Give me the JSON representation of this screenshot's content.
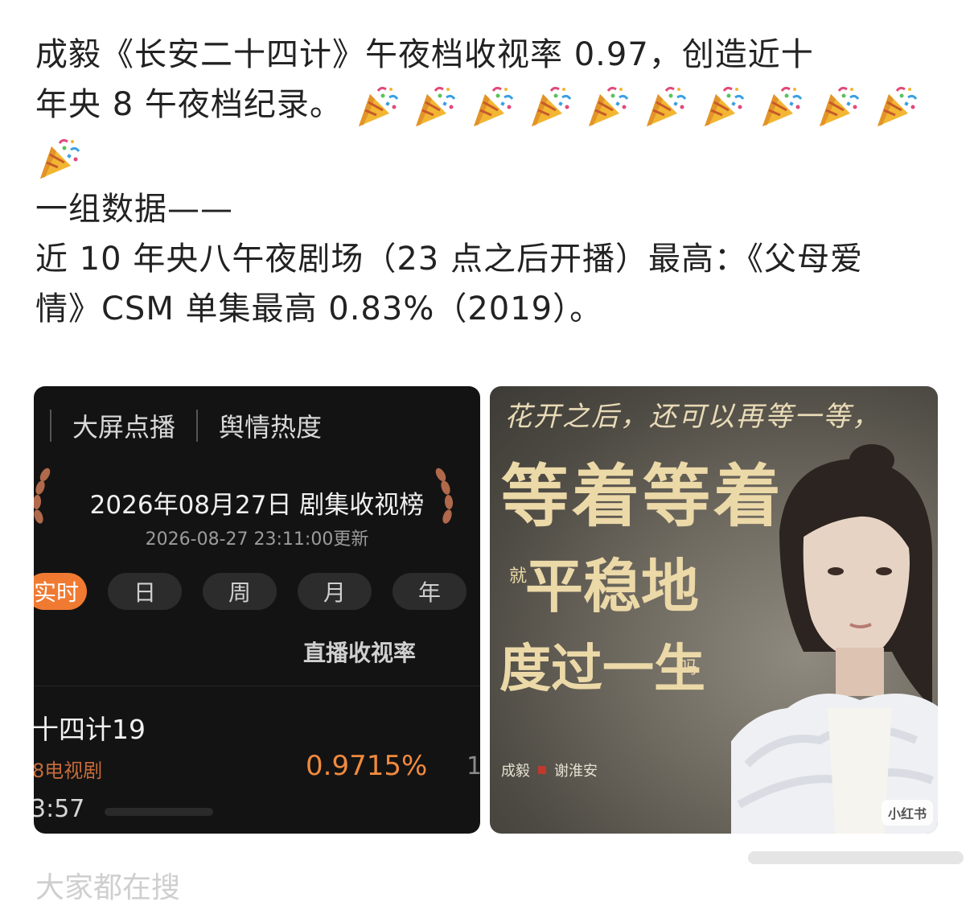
{
  "post": {
    "line1": "成毅《长安二十四计》午夜档收视率 0.97，创造近十",
    "line2": "年央 8 午夜档纪录。",
    "party_count_row1": 10,
    "party_count_row2": 1,
    "line3": "一组数据——",
    "line4": "近 10 年央八午夜剧场（23 点之后开播）最高：《父母爱",
    "line5": "情》CSM 单集最高 0.83%（2019）。",
    "emoji_icon": "party-popper-icon"
  },
  "image1": {
    "tab_sep": "|",
    "tab1": "大屏点播",
    "tab2": "舆情热度",
    "title": "2026年08月27日 剧集收视榜",
    "updated": "2026-08-27 23:11:00更新",
    "pills": [
      "实时",
      "日",
      "周",
      "月",
      "年"
    ],
    "live_label": "直播收视率",
    "show_name": "十四计19",
    "channel": "8电视剧",
    "rating": "0.9715%",
    "rank": "1",
    "time": "3:57"
  },
  "image2": {
    "top_line": "花开之后，还可以再等一等，",
    "big1": "等着等着",
    "small1": "就",
    "big2": "平稳地",
    "big3": "度过一生",
    "small2": "吗",
    "actor": "成毅",
    "role": "谢淮安",
    "watermark": "小红书"
  },
  "footer": {
    "text": "大家都在搜"
  },
  "colors": {
    "accent_orange": "#f07a32",
    "rating_orange": "#f08a3e",
    "poster_gold": "#ecd9a8"
  }
}
